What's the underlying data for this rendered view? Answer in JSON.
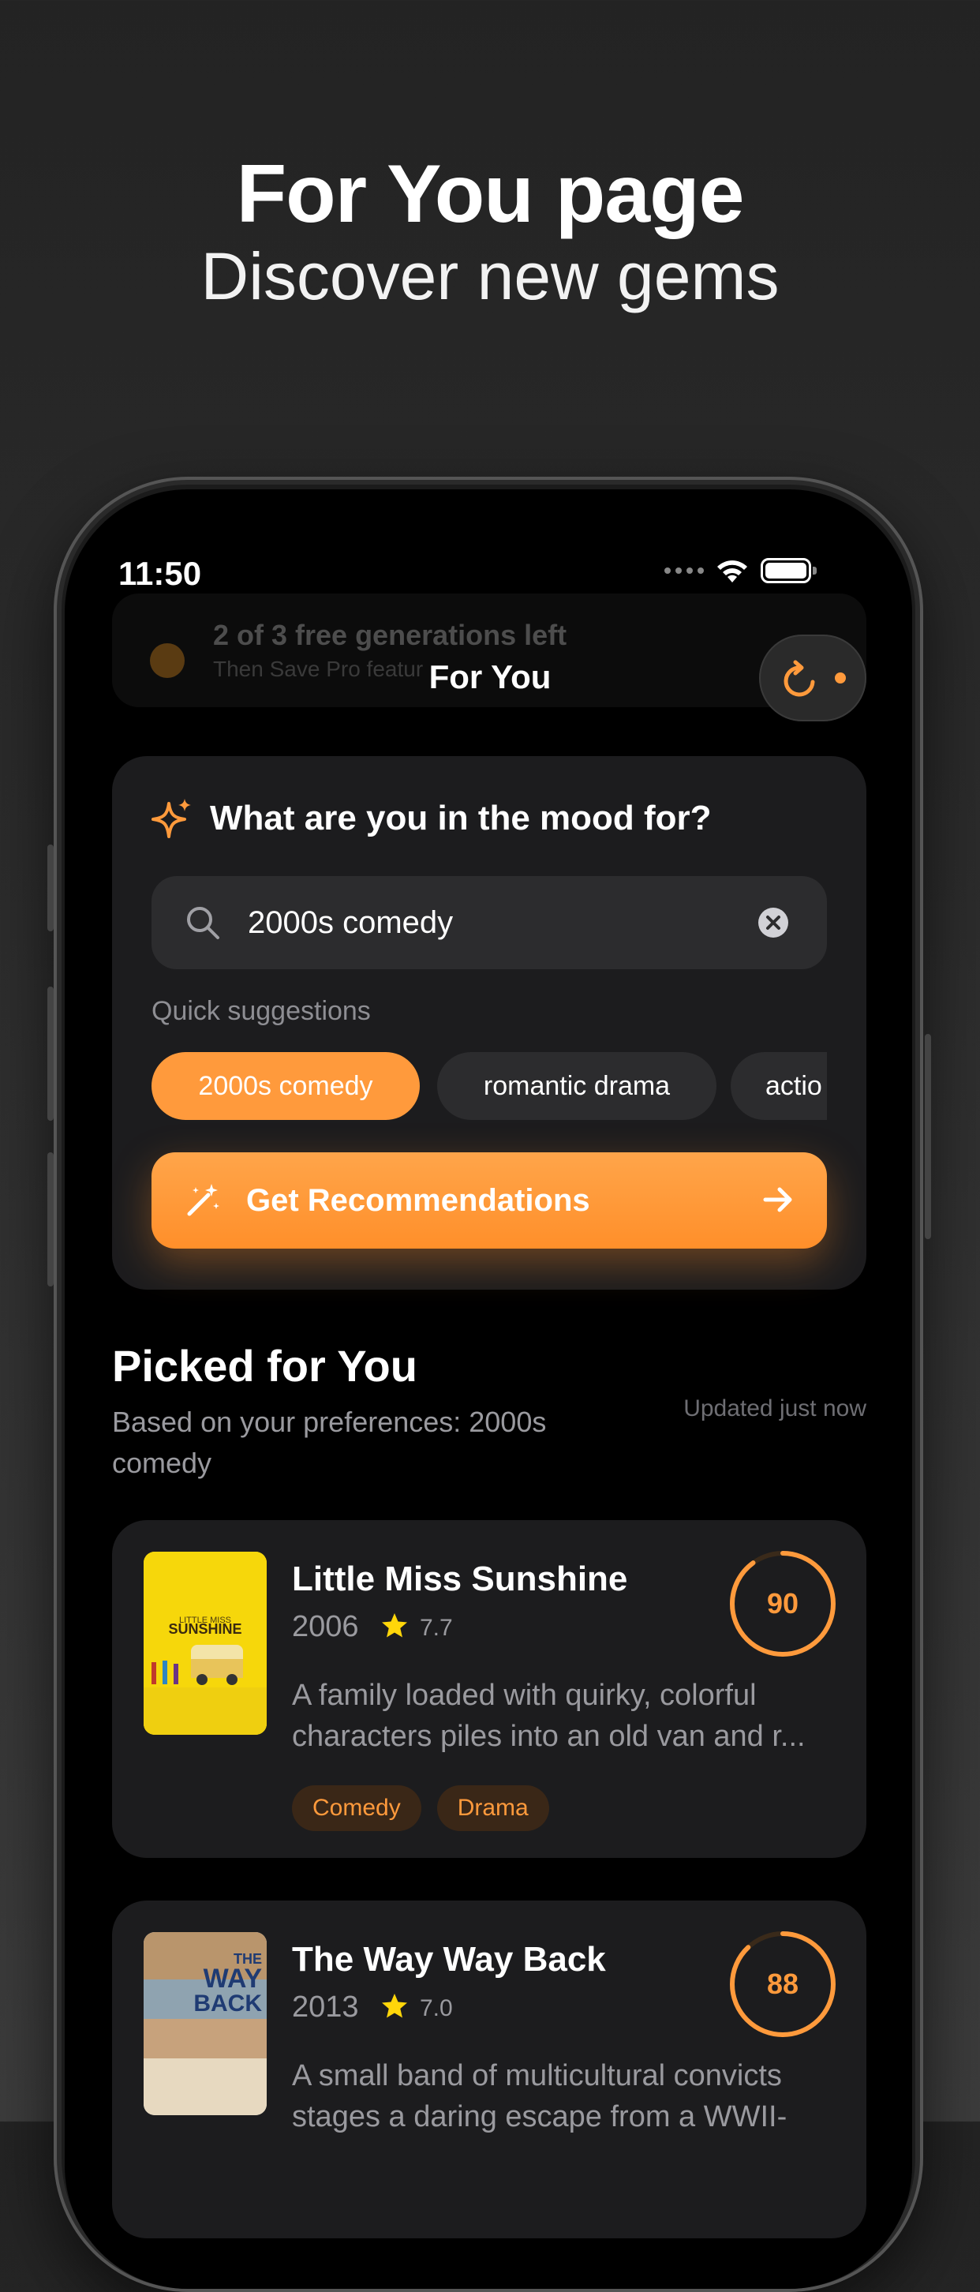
{
  "marketing": {
    "title": "For You page",
    "subtitle": "Discover new gems"
  },
  "status_bar": {
    "time": "11:50"
  },
  "banner": {
    "title": "2 of 3 free generations left",
    "subtitle": "Then Save Pro featur"
  },
  "nav": {
    "title": "For You",
    "refresh_icon": "refresh-icon"
  },
  "mood": {
    "title": "What are you in the mood for?",
    "search_value": "2000s comedy",
    "quick_label": "Quick suggestions",
    "chips": [
      "2000s comedy",
      "romantic drama",
      "actio"
    ],
    "cta_label": "Get Recommendations"
  },
  "picked": {
    "title": "Picked for You",
    "subtitle": "Based on your preferences: 2000s comedy",
    "updated": "Updated just now"
  },
  "movies": [
    {
      "title": "Little Miss Sunshine",
      "year": "2006",
      "rating": "7.7",
      "description": "A family loaded with quirky, colorful characters piles into an old van and r...",
      "genres": [
        "Comedy",
        "Drama"
      ],
      "score": "90",
      "score_fraction": 0.9,
      "poster_text": "LITTLE MISS SUNSHINE"
    },
    {
      "title": "The Way Way Back",
      "year": "2013",
      "rating": "7.0",
      "description": "A small band of multicultural convicts stages a daring escape from a WWII-",
      "genres": [],
      "score": "88",
      "score_fraction": 0.88,
      "poster_text": "THE WAY WAY BACK"
    }
  ],
  "colors": {
    "accent": "#ff9a3c",
    "card": "#1c1c1e",
    "star": "#ffd60a"
  }
}
